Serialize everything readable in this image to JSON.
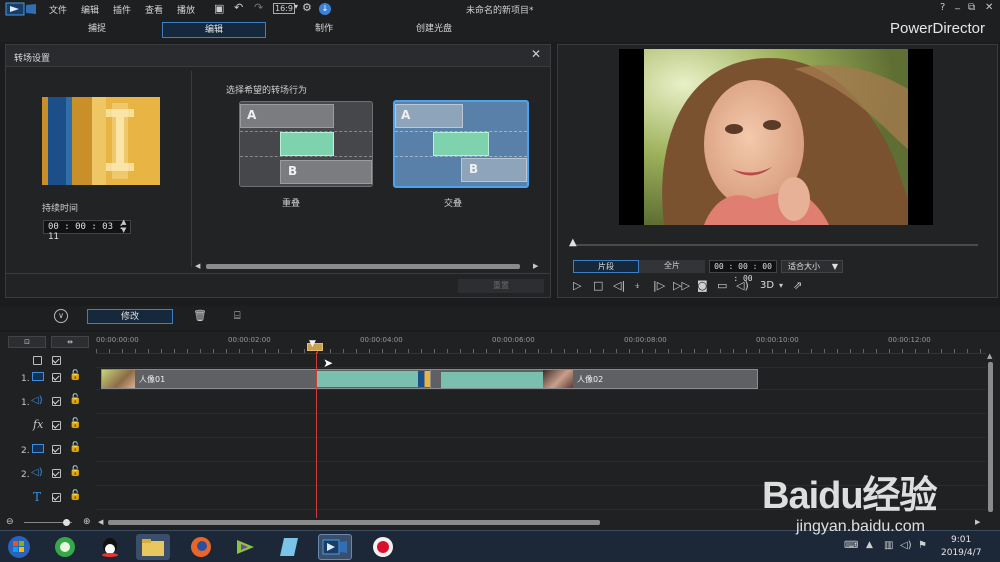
{
  "app": {
    "title": "未命名的新项目*",
    "brand": "PowerDirector"
  },
  "menu": {
    "items": [
      "文件",
      "编辑",
      "插件",
      "查看",
      "播放"
    ]
  },
  "window_controls": {
    "help": "?",
    "minimize": "_",
    "restore": "⧉",
    "close": "✕"
  },
  "tabs": {
    "capture": "捕捉",
    "edit": "编辑",
    "produce": "制作",
    "disc": "创建光盘"
  },
  "transition_dialog": {
    "title": "转场设置",
    "duration_label": "持续时间",
    "duration_value": "00 : 00 : 03 : 11",
    "behavior_label": "选择希望的转场行为",
    "option_overlap": {
      "label": "重叠",
      "a": "A",
      "b": "B"
    },
    "option_cross": {
      "label": "交叠",
      "a": "A",
      "b": "B"
    },
    "reset_button": "重置"
  },
  "preview": {
    "mode_clip": "片段",
    "mode_movie": "全片",
    "timecode": "00 : 00 : 00 : 00",
    "zoom": "适合大小",
    "three_d": "3D"
  },
  "timeline_toolbar": {
    "modify_button": "修改"
  },
  "ruler": {
    "ticks": [
      "00:00:00:00",
      "00:00:02:00",
      "00:00:04:00",
      "00:00:06:00",
      "00:00:08:00",
      "00:00:10:00",
      "00:00:12:00"
    ]
  },
  "tracks": {
    "video1": "1.",
    "audio1": "1.",
    "fx": "fx",
    "video2": "2.",
    "audio2": "2.",
    "title": "T"
  },
  "clips": {
    "clip1": "人像01",
    "clip2": "人像02"
  },
  "taskbar": {
    "time": "9:01",
    "date": "2019/4/7"
  },
  "watermark": {
    "brand": "Baidu经验",
    "url": "jingyan.baidu.com"
  },
  "colors": {
    "accent": "#3c7fc4",
    "clip_teal": "#7bbfae",
    "playhead": "#d23b3b"
  }
}
